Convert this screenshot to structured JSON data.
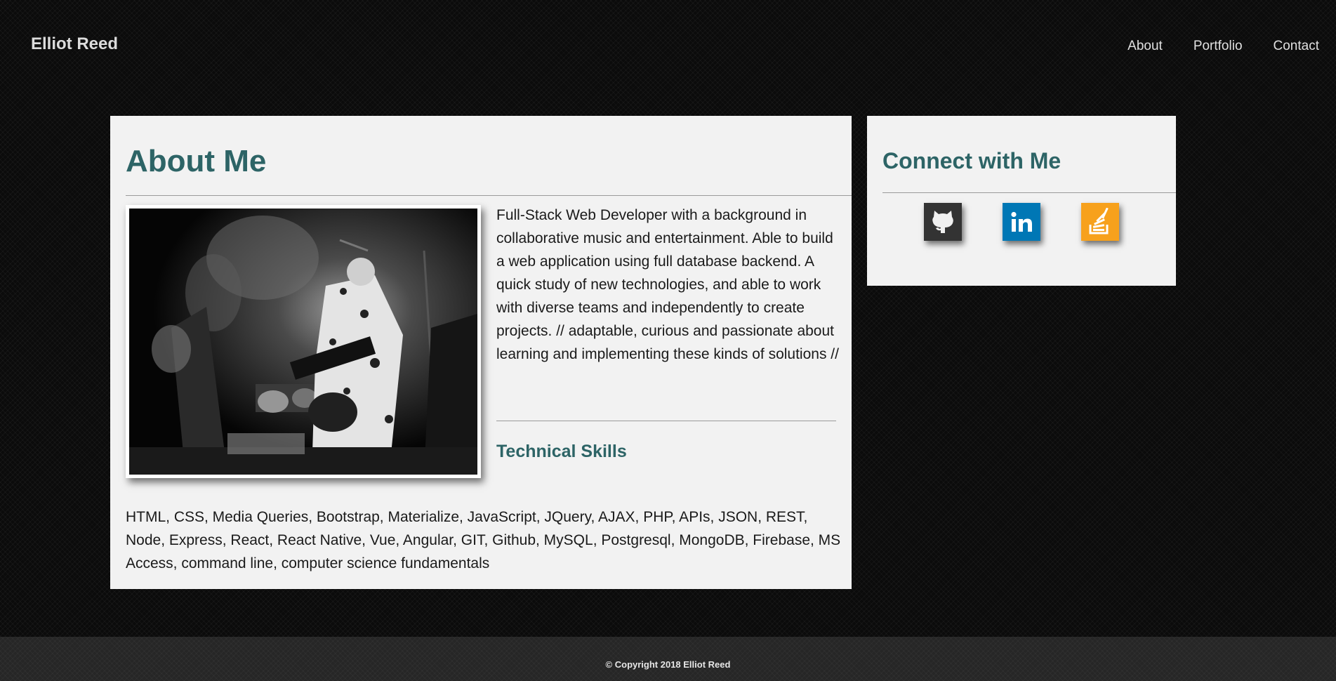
{
  "header": {
    "brand": "Elliot Reed",
    "nav": [
      "About",
      "Portfolio",
      "Contact"
    ]
  },
  "about": {
    "title": "About Me",
    "bio": "Full-Stack Web Developer with a background in collaborative music and entertainment. Able to build a web application using full database backend. A quick study of new technologies, and able to work with diverse teams and independently to create projects. // adaptable, curious and passionate about learning and implementing these kinds of solutions //",
    "skills_title": "Technical Skills",
    "skills": "HTML, CSS, Media Queries, Bootstrap, Materialize, JavaScript, JQuery, AJAX, PHP, APIs, JSON, REST, Node, Express, React, React Native, Vue, Angular, GIT, Github, MySQL, Postgresql, MongoDB, Firebase, MS Access, command line, computer science fundamentals"
  },
  "connect": {
    "title": "Connect with Me",
    "icons": [
      "github-icon",
      "linkedin-icon",
      "stackoverflow-icon"
    ],
    "colors": {
      "github": "#333333",
      "linkedin": "#0077b5",
      "stackoverflow": "#f7a11c"
    }
  },
  "footer": {
    "copyright": "© Copyright 2018 Elliot Reed"
  },
  "colors": {
    "accent": "#2d6466",
    "card": "#f2f2f2",
    "background": "#0b0b0b"
  }
}
